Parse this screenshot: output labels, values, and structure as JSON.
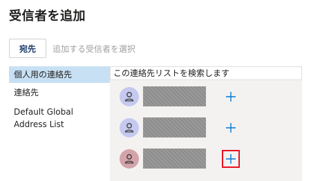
{
  "dialog": {
    "title": "受信者を追加"
  },
  "to_row": {
    "button_label": "宛先",
    "input_placeholder": "追加する受信者を選択"
  },
  "sidebar": {
    "items": [
      {
        "label": "個人用の連絡先",
        "selected": true
      },
      {
        "label": "連絡先",
        "selected": false
      },
      {
        "label": "Default Global Address List",
        "selected": false
      }
    ]
  },
  "main": {
    "search_placeholder": "この連絡先リストを検索します",
    "contacts": [
      {
        "name": "",
        "avatar_color": "#c5c9ef",
        "avatar_icon": "person-icon",
        "add_icon": "plus-icon",
        "highlighted": false
      },
      {
        "name": "",
        "avatar_color": "#c5c9ef",
        "avatar_icon": "person-icon",
        "add_icon": "plus-icon",
        "highlighted": false
      },
      {
        "name": "",
        "avatar_color": "#d4a3aa",
        "avatar_icon": "person-icon",
        "add_icon": "plus-icon",
        "highlighted": true
      }
    ]
  },
  "colors": {
    "accent": "#0078d4",
    "selected_bg": "#c7e0f4",
    "highlight_border": "#e81123"
  }
}
